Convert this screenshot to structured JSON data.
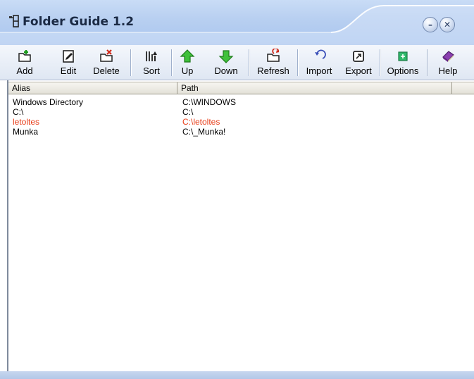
{
  "window": {
    "title": "Folder Guide 1.2",
    "minimize_symbol": "–",
    "close_symbol": "✕"
  },
  "toolbar": {
    "buttons": [
      {
        "label": "Add",
        "icon": "add-folder-icon"
      },
      {
        "label": "Edit",
        "icon": "edit-icon"
      },
      {
        "label": "Delete",
        "icon": "delete-folder-icon"
      },
      {
        "label": "Sort",
        "icon": "sort-icon"
      },
      {
        "label": "Up",
        "icon": "arrow-up-icon"
      },
      {
        "label": "Down",
        "icon": "arrow-down-icon"
      },
      {
        "label": "Refresh",
        "icon": "refresh-folder-icon"
      },
      {
        "label": "Import",
        "icon": "import-icon"
      },
      {
        "label": "Export",
        "icon": "export-icon"
      },
      {
        "label": "Options",
        "icon": "options-icon"
      },
      {
        "label": "Help",
        "icon": "help-book-icon"
      }
    ]
  },
  "list": {
    "columns": [
      "Alias",
      "Path"
    ],
    "rows": [
      {
        "alias": "Windows Directory",
        "path": "C:\\WINDOWS",
        "color": "#000000"
      },
      {
        "alias": "C:\\",
        "path": "C:\\",
        "color": "#000000"
      },
      {
        "alias": "letoltes",
        "path": "C:\\letoltes",
        "color": "#e8401c"
      },
      {
        "alias": "Munka",
        "path": "C:\\_Munka!",
        "color": "#000000"
      }
    ]
  },
  "colors": {
    "titlebar": "#b9d0f1",
    "highlight_row_text": "#e8401c"
  }
}
